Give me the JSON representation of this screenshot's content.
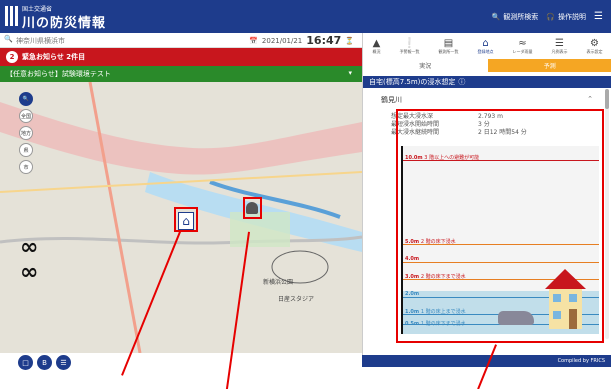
{
  "header": {
    "org": "国土交通省",
    "title": "川の防災情報",
    "search_label": "観測所検索",
    "help_label": "操作説明"
  },
  "left": {
    "search_text": "神奈川県横浜市",
    "date": "2021/01/21",
    "time": "16:47",
    "alert_count": "2",
    "alert_text": "緊急お知らせ 2件目",
    "notice_text": "【任意お知らせ】試験環境テスト"
  },
  "map": {
    "buttons": [
      "全国",
      "地方",
      "県",
      "市"
    ],
    "labels": {
      "park": "新横浜公園",
      "stadium": "日産スタジア"
    }
  },
  "right": {
    "tabs": [
      {
        "label": "概況",
        "icon": "warning-icon"
      },
      {
        "label": "予警報一覧",
        "icon": "info-icon"
      },
      {
        "label": "観測所一覧",
        "icon": "building-icon"
      },
      {
        "label": "登録地点",
        "icon": "home-icon"
      },
      {
        "label": "レーダ雨量",
        "icon": "radar-icon"
      },
      {
        "label": "凡例表示",
        "icon": "list-icon"
      },
      {
        "label": "表示設定",
        "icon": "wrench-icon"
      }
    ],
    "modes": {
      "live": "実況",
      "forecast": "予測"
    },
    "panel_title": "自宅(標高7.5m)の浸水想定",
    "river": "鶴見川",
    "stats": [
      {
        "label": "想定最大浸水深",
        "value": "2.793 m"
      },
      {
        "label": "最短浸水開始時間",
        "value": "3 分"
      },
      {
        "label": "最大浸水継続時間",
        "value": "2 日12 時間54 分"
      }
    ],
    "levels": [
      {
        "label": "10.0m",
        "note": "3 階以上への避難が可能"
      },
      {
        "label": "5.0m",
        "note": "2 階の床下浸水"
      },
      {
        "label": "4.0m",
        "note": ""
      },
      {
        "label": "3.0m",
        "note": "2 階の床下まで浸水"
      },
      {
        "label": "2.0m",
        "note": ""
      },
      {
        "label": "1.0m",
        "note": "1 階の床上まで浸水"
      },
      {
        "label": "0.5m",
        "note": "1 階の床下まで浸水"
      }
    ],
    "credit": "Compiled by FRICS"
  }
}
